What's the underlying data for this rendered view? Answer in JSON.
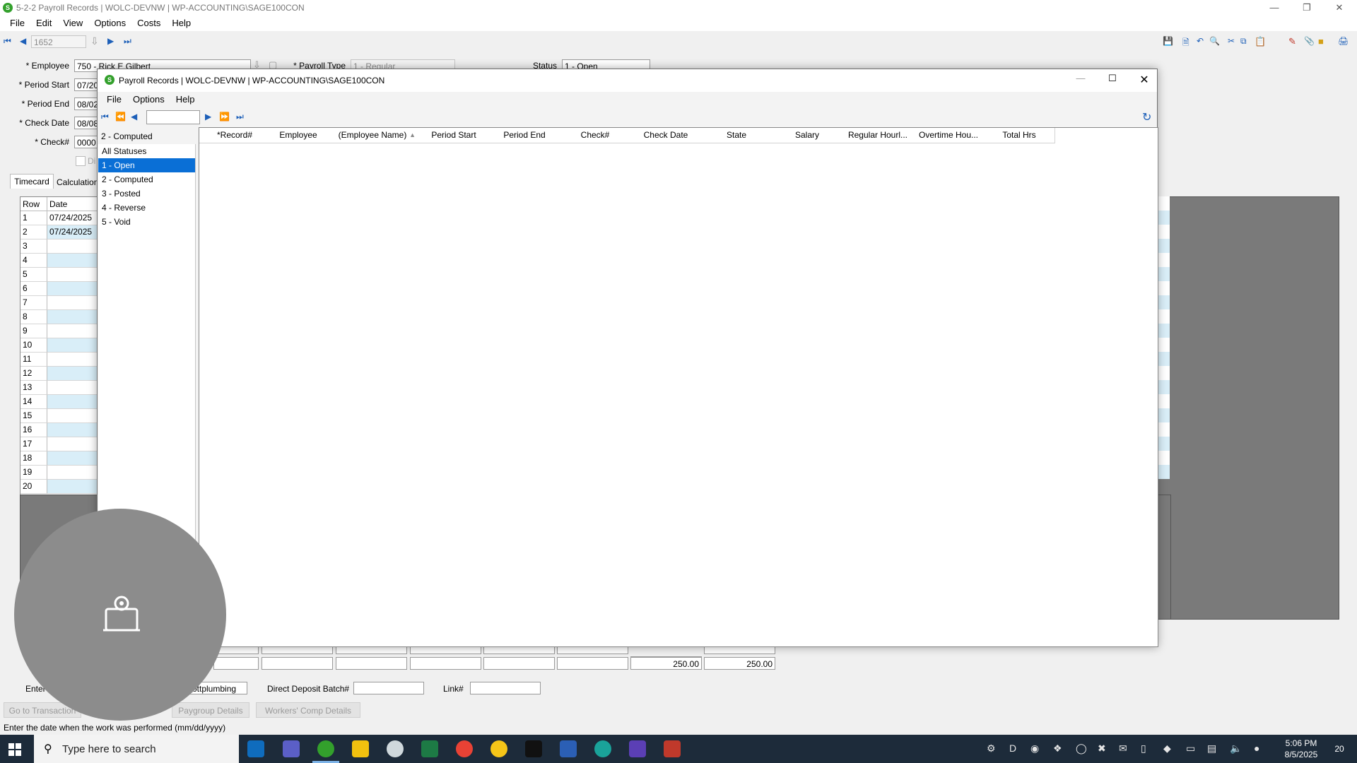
{
  "main_window": {
    "title": "5-2-2 Payroll Records  |  WOLC-DEVNW  |  WP-ACCOUNTING\\SAGE100CON",
    "menu": [
      "File",
      "Edit",
      "View",
      "Options",
      "Costs",
      "Help"
    ],
    "record_number": "1652",
    "form": {
      "employee_label": "* Employee",
      "employee_value": "750 - Rick E Gilbert",
      "period_start_label": "* Period Start",
      "period_start_value": "07/20",
      "period_end_label": "* Period End",
      "period_end_value": "08/02",
      "check_date_label": "* Check Date",
      "check_date_value": "08/08",
      "check_num_label": "* Check#",
      "check_num_value": "0000",
      "dir_label": "Di",
      "payroll_type_label": "* Payroll Type",
      "payroll_type_value": "1 - Regular",
      "status_label": "Status",
      "status_value": "1 - Open"
    },
    "tabs": [
      "Timecard",
      "Calculation"
    ],
    "grid": {
      "headers": [
        "Row",
        "Date"
      ],
      "rows": [
        {
          "row": "1",
          "date": "07/24/2025"
        },
        {
          "row": "2",
          "date": "07/24/2025"
        },
        {
          "row": "3",
          "date": ""
        },
        {
          "row": "4",
          "date": ""
        },
        {
          "row": "5",
          "date": ""
        },
        {
          "row": "6",
          "date": ""
        },
        {
          "row": "7",
          "date": ""
        },
        {
          "row": "8",
          "date": ""
        },
        {
          "row": "9",
          "date": ""
        },
        {
          "row": "10",
          "date": ""
        },
        {
          "row": "11",
          "date": ""
        },
        {
          "row": "12",
          "date": ""
        },
        {
          "row": "13",
          "date": ""
        },
        {
          "row": "14",
          "date": ""
        },
        {
          "row": "15",
          "date": ""
        },
        {
          "row": "16",
          "date": ""
        },
        {
          "row": "17",
          "date": ""
        },
        {
          "row": "18",
          "date": ""
        },
        {
          "row": "19",
          "date": ""
        },
        {
          "row": "20",
          "date": ""
        }
      ]
    },
    "totals": {
      "total_1": "250.00",
      "total_2": "250.00"
    },
    "bottom": {
      "entered_label": "Enter",
      "company_value": "cottplumbing",
      "direct_deposit_label": "Direct Deposit Batch#",
      "link_label": "Link#",
      "buttons": [
        "Go to Transaction",
        "Paygroup Details",
        "Workers' Comp Details"
      ]
    },
    "status_bar": "Enter the date when the work was performed (mm/dd/yyyy)"
  },
  "dialog": {
    "title": "Payroll Records  |  WOLC-DEVNW  |  WP-ACCOUNTING\\SAGE100CON",
    "menu": [
      "File",
      "Options",
      "Help"
    ],
    "search_value": "",
    "status_filter_current": "2 - Computed",
    "status_options": [
      "All Statuses",
      "1 - Open",
      "2 - Computed",
      "3 - Posted",
      "4 - Reverse",
      "5 - Void"
    ],
    "selected_status": "1 - Open",
    "columns": [
      "*Record#",
      "Employee",
      "(Employee Name)",
      "Period Start",
      "Period End",
      "Check#",
      "Check Date",
      "State",
      "Salary",
      "Regular Hourl...",
      "Overtime Hou...",
      "Total Hrs"
    ]
  },
  "taskbar": {
    "search_placeholder": "Type here to search",
    "time": "5:06 PM",
    "date": "8/5/2025",
    "notification_count": "20"
  },
  "colors": {
    "selection": "#0a6fd6",
    "taskbar": "#1d2b3a",
    "grid_alt_row": "#d9eef8"
  }
}
